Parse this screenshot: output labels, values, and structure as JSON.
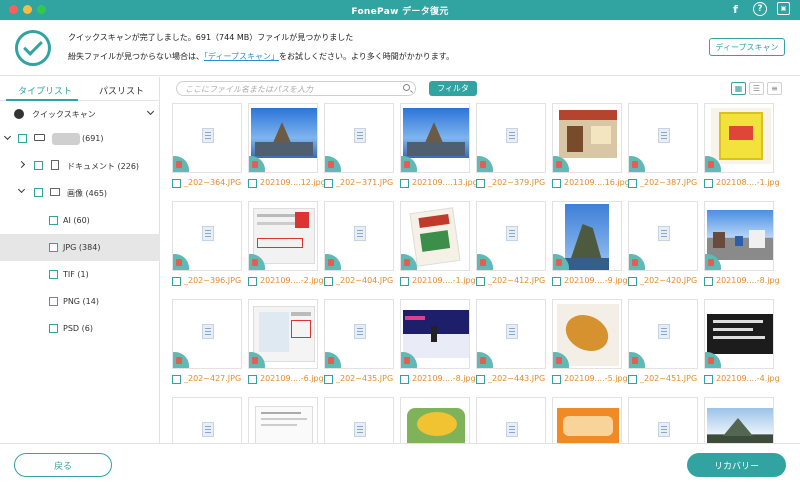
{
  "app": {
    "title": "FonePaw データ復元",
    "traffic_lights": [
      "#fc605c",
      "#fdbc40",
      "#34c84a"
    ],
    "accent": "#31a3a1",
    "filename_color": "#e38c2a",
    "icons": [
      "facebook-icon",
      "help-icon",
      "save-icon"
    ],
    "facebook_glyph": "f",
    "help_glyph": "?",
    "save_glyph": "▣"
  },
  "header": {
    "message_line1": "クイックスキャンが完了しました。691（744 MB）ファイルが見つかりました",
    "message_line2_before": "紛失ファイルが見つからない場合は、",
    "message_line2_link": "「ディープスキャン」",
    "message_line2_after": "をお試しください。より多く時間がかかります。",
    "deep_scan_button": "ディープスキャン"
  },
  "sidebar": {
    "tabs": [
      "タイプリスト",
      "パスリスト"
    ],
    "active_tab": 0,
    "scan_mode": "クイックスキャン",
    "drive_count": "(691)",
    "documents_label": "ドキュメント (226)",
    "images_label": "画像 (465)",
    "image_types": [
      {
        "label": "AI (60)",
        "selected": false
      },
      {
        "label": "JPG (384)",
        "selected": true
      },
      {
        "label": "TIF (1)",
        "selected": false
      },
      {
        "label": "PNG (14)",
        "selected": false
      },
      {
        "label": "PSD (6)",
        "selected": false
      }
    ]
  },
  "toolbar": {
    "search_placeholder": "ここにファイル名またはパスを入力",
    "filter_button": "フィルタ",
    "view_icons": [
      "grid-view-icon",
      "list-view-icon",
      "detail-view-icon"
    ]
  },
  "files": [
    {
      "name": "_202~364.JPG",
      "thumb": "placeholder"
    },
    {
      "name": "202109....12.jpg",
      "thumb": "rocks"
    },
    {
      "name": "_202~371.JPG",
      "thumb": "placeholder"
    },
    {
      "name": "202109....13.jpg",
      "thumb": "rocks"
    },
    {
      "name": "_202~379.JPG",
      "thumb": "placeholder"
    },
    {
      "name": "202109....16.jpg",
      "thumb": "shop"
    },
    {
      "name": "_202~387.JPG",
      "thumb": "placeholder"
    },
    {
      "name": "202108....-1.jpg",
      "thumb": "snack"
    },
    {
      "name": "_202~396.JPG",
      "thumb": "placeholder"
    },
    {
      "name": "202109....-2.jpg",
      "thumb": "screenshot"
    },
    {
      "name": "_202~404.JPG",
      "thumb": "placeholder"
    },
    {
      "name": "202109....-1.jpg",
      "thumb": "package"
    },
    {
      "name": "_202~412.JPG",
      "thumb": "placeholder"
    },
    {
      "name": "202109....-9.jpg",
      "thumb": "tallrock"
    },
    {
      "name": "_202~420.JPG",
      "thumb": "placeholder"
    },
    {
      "name": "202109....-8.jpg",
      "thumb": "street"
    },
    {
      "name": "_202~427.JPG",
      "thumb": "placeholder"
    },
    {
      "name": "202109....-6.jpg",
      "thumb": "map"
    },
    {
      "name": "_202~435.JPG",
      "thumb": "placeholder"
    },
    {
      "name": "202109....-8.jpg",
      "thumb": "skate"
    },
    {
      "name": "_202~443.JPG",
      "thumb": "placeholder"
    },
    {
      "name": "202109....-5.jpg",
      "thumb": "croquette"
    },
    {
      "name": "_202~451.JPG",
      "thumb": "placeholder"
    },
    {
      "name": "202109....-4.jpg",
      "thumb": "board"
    },
    {
      "name": "",
      "thumb": "placeholder"
    },
    {
      "name": "",
      "thumb": "document"
    },
    {
      "name": "",
      "thumb": "placeholder"
    },
    {
      "name": "",
      "thumb": "cake"
    },
    {
      "name": "",
      "thumb": "placeholder"
    },
    {
      "name": "",
      "thumb": "food"
    },
    {
      "name": "",
      "thumb": "placeholder"
    },
    {
      "name": "",
      "thumb": "mountain"
    }
  ],
  "footer": {
    "back_button": "戻る",
    "recover_button": "リカバリー"
  }
}
